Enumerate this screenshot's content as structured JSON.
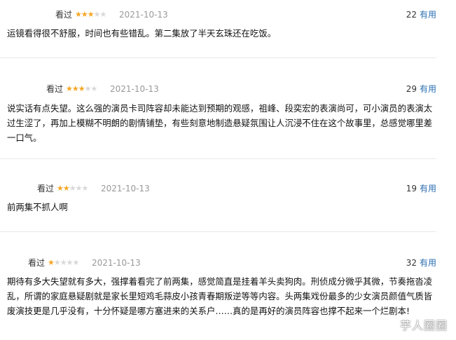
{
  "reviews": [
    {
      "user": "  ",
      "status": "看过",
      "rating": 3,
      "date": "2021-10-13",
      "votes": "22",
      "useful_label": "有用",
      "text": "运镜看得很不舒服，时间也有些错乱。第二集放了半天玄珠还在吃饭。"
    },
    {
      "user": "",
      "status": "看过",
      "rating": 3,
      "date": "2021-10-13",
      "votes": "29",
      "useful_label": "有用",
      "text": "说实话有点失望。这么强的演员卡司阵容却未能达到预期的观感，祖峰、段奕宏的表演尚可，可小演员的表演太过生涩了，再加上模糊不明朗的剧情铺垫，有些刻意地制造悬疑氛围让人沉浸不住在这个故事里，总感觉哪里差一口气。"
    },
    {
      "user": "",
      "status": "看过",
      "rating": 2,
      "date": "2021-10-13",
      "votes": "19",
      "useful_label": "有用",
      "text": "前两集不抓人啊"
    },
    {
      "user": "",
      "status": "看过",
      "rating": 1,
      "date": "2021-10-13",
      "votes": "32",
      "useful_label": "有用",
      "text": "期待有多大失望就有多大，强撑着看完了前两集，感觉简直是挂着羊头卖狗肉。刑侦成分微乎其微，节奏拖沓凌乱，所谓的家庭悬疑剧就是家长里短鸡毛蒜皮小孩青春期叛逆等等内容。头两集戏份最多的少女演员颜值气质皆废演技更是几乎没有，十分怀疑是哪方塞进来的关系户……真的是再好的演员阵容也撑不起来一个烂剧本!"
    }
  ],
  "watermark": "芋人圈圈",
  "colors": {
    "star_on": "#f5a623",
    "star_off": "#d8d8d8",
    "useful_link": "#2a6eb0"
  }
}
